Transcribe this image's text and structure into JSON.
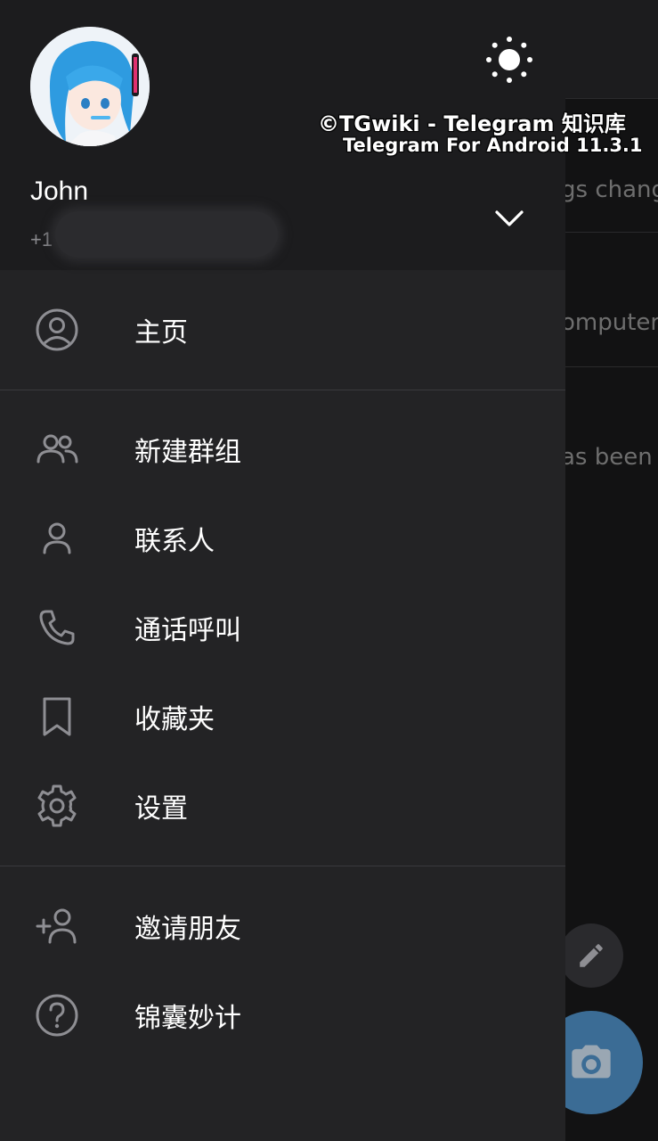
{
  "background": {
    "snippets": [
      "gs chang",
      "omputer",
      "as been c"
    ]
  },
  "drawer": {
    "user": {
      "name": "John",
      "phone_prefix": "+1"
    },
    "menu": [
      {
        "id": "home",
        "label": "主页",
        "icon": "profile-circle-icon"
      },
      {
        "id": "new-group",
        "label": "新建群组",
        "icon": "group-icon"
      },
      {
        "id": "contacts",
        "label": "联系人",
        "icon": "person-icon"
      },
      {
        "id": "calls",
        "label": "通话呼叫",
        "icon": "phone-icon"
      },
      {
        "id": "saved",
        "label": "收藏夹",
        "icon": "bookmark-icon"
      },
      {
        "id": "settings",
        "label": "设置",
        "icon": "gear-icon"
      },
      {
        "id": "invite",
        "label": "邀请朋友",
        "icon": "add-person-icon"
      },
      {
        "id": "tips",
        "label": "锦囊妙计",
        "icon": "question-circle-icon"
      }
    ]
  },
  "watermark": {
    "line1": "©TGwiki - Telegram 知识库",
    "line2": "Telegram For Android 11.3.1"
  },
  "colors": {
    "drawer_bg": "#232325",
    "header_bg": "#1c1c1e",
    "icon": "#8e8e93",
    "accent_fab": "#3b6c95"
  }
}
